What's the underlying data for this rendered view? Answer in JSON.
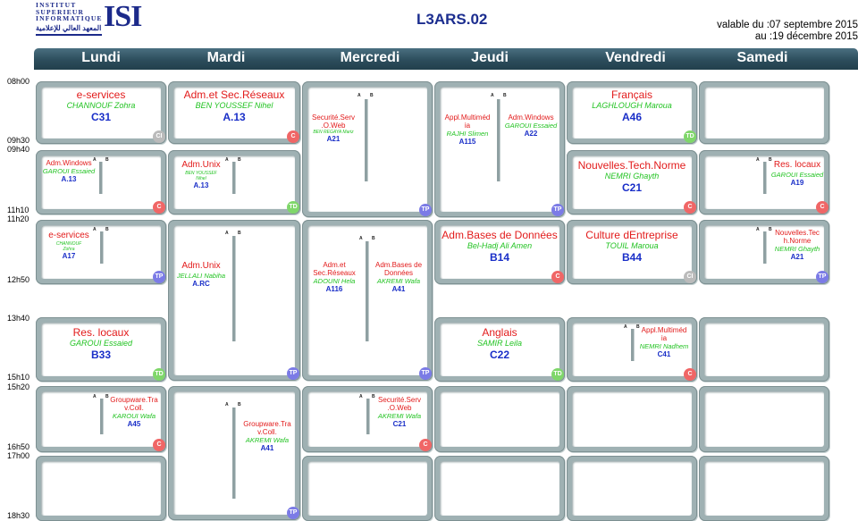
{
  "header": {
    "logo_lines": [
      "INSTITUT",
      "SUPERIEUR",
      "INFORMATIQUE"
    ],
    "logo_big": "ISI",
    "logo_arabic": "المعهد العالي للإعلامية",
    "title": "L3ARS.02",
    "valid_from": "valable du :07 septembre 2015",
    "valid_to": "au :19 décembre 2015"
  },
  "days": [
    "Lundi",
    "Mardi",
    "Mercredi",
    "Jeudi",
    "Vendredi",
    "Samedi"
  ],
  "times": [
    "08h00",
    "09h30",
    "09h40",
    "11h10",
    "11h20",
    "12h50",
    "13h40",
    "15h10",
    "15h20",
    "16h50",
    "17h00",
    "18h30"
  ],
  "ab": {
    "a": "A",
    "b": "B"
  },
  "slots": {
    "mon1": {
      "subject": "e-services",
      "teacher": "CHANNOUF Zohra",
      "room": "C31",
      "type": "CI"
    },
    "tue1": {
      "subject": "Adm.et Sec.Réseaux",
      "teacher": "BEN YOUSSEF Nihel",
      "room": "A.13",
      "type": "C"
    },
    "wed1": {
      "subject": "Securité.Serv.O.Web",
      "subject_l1": "Securité.Serv",
      "subject_l2": ".O.Web",
      "teacher": "BEN REGAYA Mariz",
      "room": "A21",
      "type": "TP"
    },
    "thu1": {
      "left_subject_l1": "Appl.Multiméd",
      "left_subject_l2": "ia",
      "left_teacher": "RAJHI Slimen",
      "left_room": "A115",
      "right_subject": "Adm.Windows",
      "right_teacher": "GAROUI Essaied",
      "right_room": "A22",
      "type": "TP"
    },
    "fri1": {
      "subject": "Français",
      "teacher": "LAGHLOUGH Maroua",
      "room": "A46",
      "type": "TD"
    },
    "mon2": {
      "subject": "Adm.Windows",
      "teacher": "GAROUI Essaied",
      "room": "A.13",
      "type": "C"
    },
    "tue2": {
      "subject": "Adm.Unix",
      "teacher_l1": "BEN YOUSSEF",
      "teacher_l2": "Nihel",
      "room": "A.13",
      "type": "TD"
    },
    "fri2": {
      "subject": "Nouvelles.Tech.Norme",
      "teacher": "NEMRI Ghayth",
      "room": "C21",
      "type": "C"
    },
    "sat2": {
      "subject": "Res. locaux",
      "teacher": "GAROUI Essaied",
      "room": "A19",
      "type": "C"
    },
    "mon3": {
      "subject": "e-services",
      "teacher_l1": "CHANNOUF",
      "teacher_l2": "Zohra",
      "room": "A17",
      "type": "TP"
    },
    "tue3": {
      "subject": "Adm.Unix",
      "teacher": "JELLALI Nabiha",
      "room": "A.RC",
      "type": "TP"
    },
    "wed3": {
      "left_subject_l1": "Adm.et",
      "left_subject_l2": "Sec.Réseaux",
      "left_teacher": "ADOUNI Hela",
      "left_room": "A116",
      "right_subject_l1": "Adm.Bases de",
      "right_subject_l2": "Données",
      "right_teacher": "AKREMI Wafa",
      "right_room": "A41",
      "type": "TP"
    },
    "thu3": {
      "subject": "Adm.Bases de Données",
      "teacher": "Bel-Hadj Ali Amen",
      "room": "B14",
      "type": "C"
    },
    "fri3": {
      "subject": "Culture dEntreprise",
      "teacher": "TOUIL Maroua",
      "room": "B44",
      "type": "CI"
    },
    "sat3": {
      "subject_l1": "Nouvelles.Tec",
      "subject_l2": "h.Norme",
      "teacher": "NEMRI Ghayth",
      "room": "A21",
      "type": "TP"
    },
    "mon4": {
      "subject": "Res. locaux",
      "teacher": "GAROUI Essaied",
      "room": "B33",
      "type": "TD"
    },
    "thu4": {
      "subject": "Anglais",
      "teacher": "SAMIR Leila",
      "room": "C22",
      "type": "TD"
    },
    "fri4": {
      "subject_l1": "Appl.Multiméd",
      "subject_l2": "ia",
      "teacher": "NEMRI Nadhem",
      "room": "C41",
      "type": "C"
    },
    "mon5": {
      "subject_l1": "Groupware.Tra",
      "subject_l2": "v.Coll.",
      "teacher": "KAROUI Wafa",
      "room": "A45",
      "type": "C"
    },
    "tue5": {
      "subject_l1": "Groupware.Tra",
      "subject_l2": "v.Coll.",
      "teacher": "AKREMI Wafa",
      "room": "A41",
      "type": "TP"
    },
    "wed5": {
      "subject_l1": "Securité.Serv",
      "subject_l2": ".O.Web",
      "teacher": "AKREMI Wafa",
      "room": "C21",
      "type": "C"
    }
  }
}
